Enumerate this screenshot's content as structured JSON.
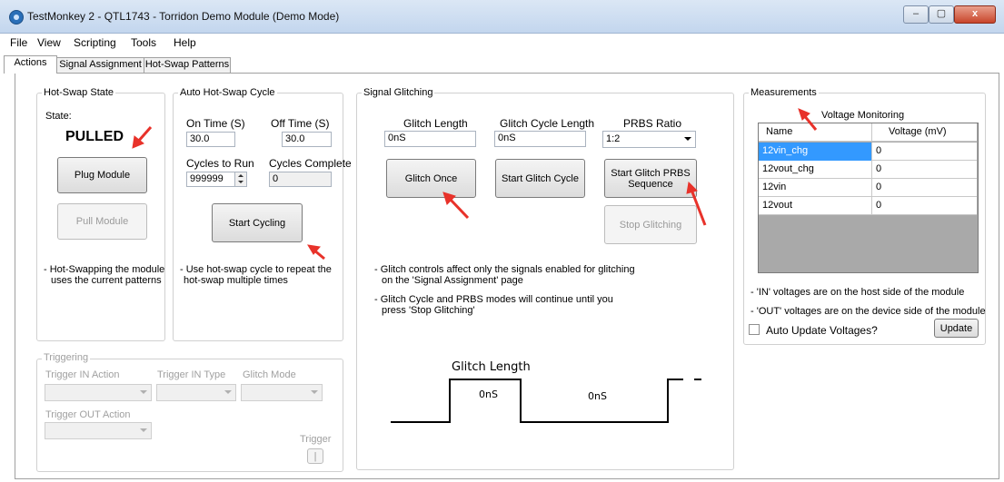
{
  "window": {
    "title": "TestMonkey 2 - QTL1743 - Torridon Demo Module (Demo Mode)",
    "minimize": "–",
    "maximize": "▢",
    "close": "x"
  },
  "menu": [
    "File",
    "View",
    "Scripting",
    "Tools",
    "Help"
  ],
  "tabs": [
    "Actions",
    "Signal Assignment",
    "Hot-Swap Patterns"
  ],
  "hot_swap_state": {
    "title": "Hot-Swap State",
    "state_label": "State:",
    "state_value": "PULLED",
    "plug_button": "Plug Module",
    "pull_button": "Pull Module",
    "note_line1": "- Hot-Swapping the module",
    "note_line2": "uses the current patterns"
  },
  "auto_cycle": {
    "title": "Auto Hot-Swap Cycle",
    "on_time_label": "On Time (S)",
    "on_time_value": "30.0",
    "off_time_label": "Off Time (S)",
    "off_time_value": "30.0",
    "cycles_to_run_label": "Cycles to Run",
    "cycles_to_run_value": "999999",
    "cycles_complete_label": "Cycles Complete",
    "cycles_complete_value": "0",
    "start_button": "Start Cycling",
    "note_line1": "- Use hot-swap cycle to repeat the",
    "note_line2": "hot-swap multiple times"
  },
  "triggering": {
    "title": "Triggering",
    "trigger_in_action_label": "Trigger IN Action",
    "trigger_in_type_label": "Trigger IN Type",
    "glitch_mode_label": "Glitch Mode",
    "trigger_out_action_label": "Trigger OUT Action",
    "trigger_label": "Trigger",
    "trigger_button": "|"
  },
  "signal_glitching": {
    "title": "Signal Glitching",
    "glitch_length_label": "Glitch Length",
    "glitch_length_value": "0nS",
    "glitch_cycle_length_label": "Glitch Cycle Length",
    "glitch_cycle_length_value": "0nS",
    "prbs_ratio_label": "PRBS Ratio",
    "prbs_ratio_value": "1:2",
    "glitch_once_button": "Glitch Once",
    "start_glitch_cycle_button": "Start Glitch Cycle",
    "start_prbs_line1": "Start Glitch PRBS",
    "start_prbs_line2": "Sequence",
    "stop_glitching_button": "Stop Glitching",
    "note1_line1": "- Glitch controls affect only the signals enabled for glitching",
    "note1_line2": "on the 'Signal Assignment' page",
    "note2_line1": "- Glitch Cycle and PRBS modes will continue until you",
    "note2_line2": "press 'Stop Glitching'",
    "diagram": {
      "title": "Glitch Length",
      "high_value": "0nS",
      "low_value": "0nS"
    }
  },
  "measurements": {
    "title": "Measurements",
    "grid_title": "Voltage Monitoring",
    "columns": [
      "Name",
      "Voltage (mV)"
    ],
    "rows": [
      {
        "name": "12vin_chg",
        "voltage": "0"
      },
      {
        "name": "12vout_chg",
        "voltage": "0"
      },
      {
        "name": "12vin",
        "voltage": "0"
      },
      {
        "name": "12vout",
        "voltage": "0"
      }
    ],
    "note_in": "- 'IN' voltages are on the host side of the module",
    "note_out": "- 'OUT' voltages are on the device side of the module",
    "auto_update_label": "Auto Update Voltages?",
    "auto_update_checked": false,
    "update_button": "Update"
  },
  "colors": {
    "annotation_arrow": "#e8322a",
    "selected_row": "#3399ff"
  }
}
